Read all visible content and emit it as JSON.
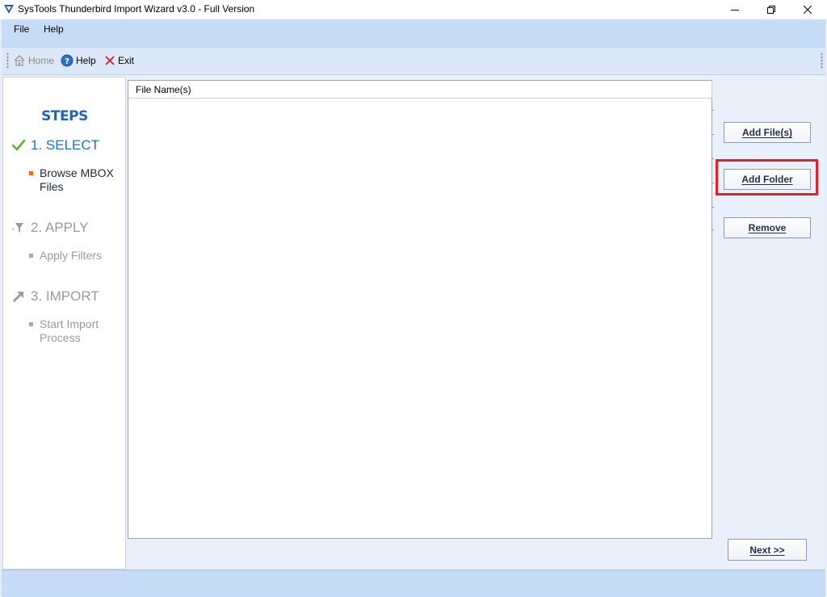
{
  "window": {
    "title": "SysTools Thunderbird Import Wizard v3.0 - Full Version",
    "minimize_label": "minimize",
    "maximize_label": "restore",
    "close_label": "close"
  },
  "menu": {
    "items": [
      {
        "label": "File"
      },
      {
        "label": "Help"
      }
    ]
  },
  "toolbar": {
    "home_label": "Home",
    "help_label": "Help",
    "exit_label": "Exit",
    "home_enabled": false
  },
  "steps": {
    "title": "STEPS",
    "items": [
      {
        "heading": "1. SELECT",
        "sub": "Browse MBOX Files",
        "status": "done",
        "icon": "check-icon"
      },
      {
        "heading": "2. APPLY",
        "sub": "Apply Filters",
        "status": "pending",
        "icon": "filter-icon"
      },
      {
        "heading": "3. IMPORT",
        "sub": "Start Import Process",
        "status": "pending",
        "icon": "arrow-up-right-icon"
      }
    ]
  },
  "file_list": {
    "column_header": "File Name(s)",
    "rows": []
  },
  "buttons": {
    "add_files": "Add File(s)",
    "add_folder": "Add Folder",
    "remove": "Remove",
    "next": "Next >>"
  },
  "colors": {
    "accent": "#1a73d0",
    "highlight": "#e3212b",
    "menubar": "#c7dcf7",
    "bullet_active": "#f26b1d"
  }
}
